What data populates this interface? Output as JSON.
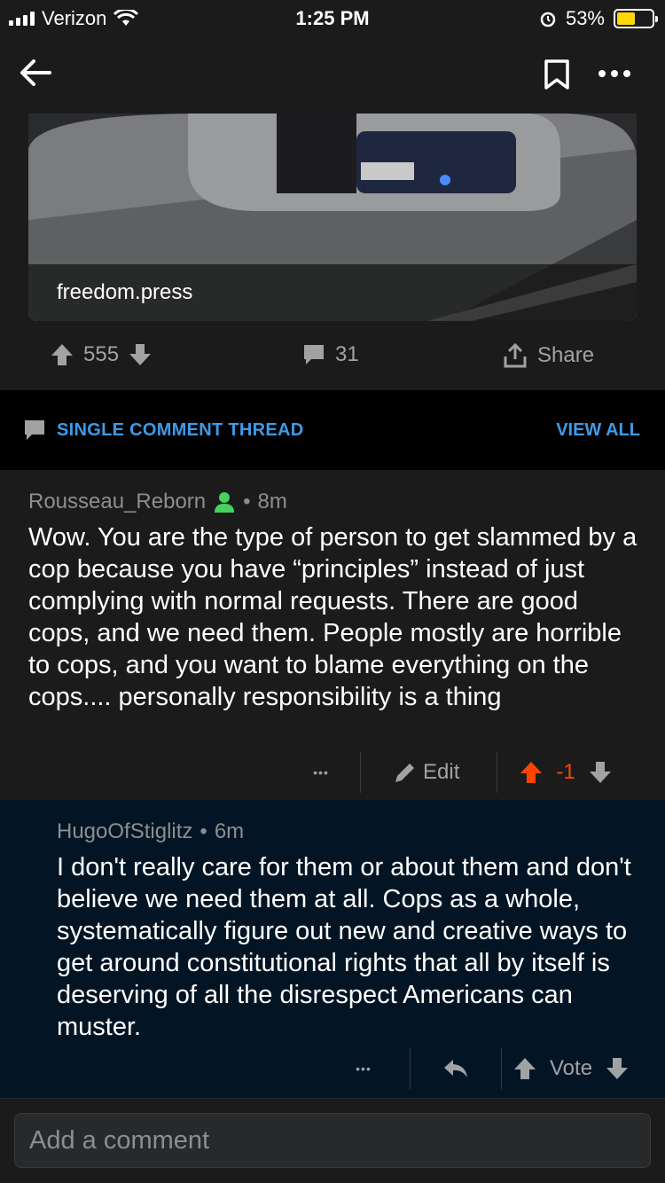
{
  "status_bar": {
    "carrier": "Verizon",
    "time": "1:25 PM",
    "battery": "53%",
    "battery_level": 0.53
  },
  "post": {
    "domain": "freedom.press",
    "score": "555",
    "comments": "31",
    "share_label": "Share"
  },
  "thread": {
    "label": "SINGLE COMMENT THREAD",
    "view_all": "VIEW ALL"
  },
  "comments": [
    {
      "author": "Rousseau_Reborn",
      "separator": "•",
      "age": "8m",
      "body": "Wow. You are the type of person to get slammed by a cop because you have “principles” instead of just complying with normal requests. There are good cops, and we need them. People mostly are horrible to cops, and you want to blame everything on the cops.... personally responsibility is a thing",
      "more": "•••",
      "edit_label": "Edit",
      "score": "-1"
    },
    {
      "author": "HugoOfStiglitz",
      "separator": "•",
      "age": "6m",
      "body": "I don't really care for them or about them and don't believe we need them at all.  Cops as a whole, systematically figure out new and creative ways to get around constitutional rights that all by itself is deserving of all the disrespect Americans can muster.",
      "more": "•••",
      "vote_label": "Vote"
    }
  ],
  "composer": {
    "placeholder": "Add a comment"
  },
  "colors": {
    "accent_blue": "#3d9bea",
    "upvote_orange": "#ff4500",
    "op_green": "#46d160"
  }
}
